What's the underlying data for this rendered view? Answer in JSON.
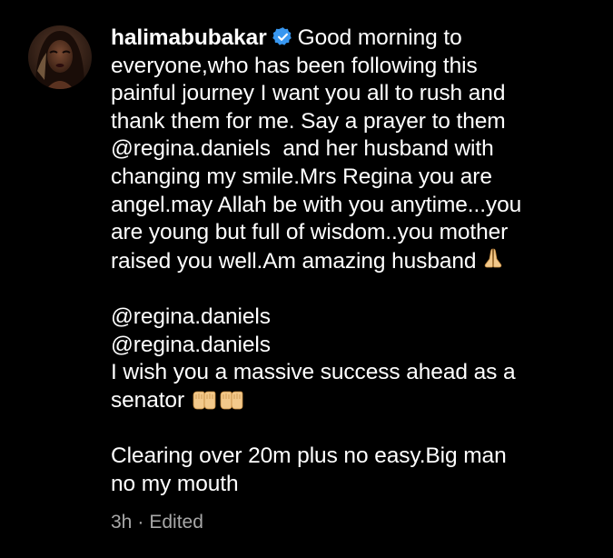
{
  "comment": {
    "username": "halimabubakar",
    "verified": true,
    "verified_color": "#3897f0",
    "text_lines": {
      "l0": "Good morning to",
      "l1": "everyone,who has been following this",
      "l2": "painful journey I want you all to rush and",
      "l3": "thank them for me. Say a prayer to them",
      "l4_mention": "@regina.daniels",
      "l4_rest": "  and her husband with",
      "l5": "changing my smile.Mrs Regina you are",
      "l6": "angel.may Allah be with you anytime...you",
      "l7": "are young but full of wisdom..you mother",
      "l8": "raised you well.Am amazing husband",
      "l10": "@regina.daniels",
      "l11": "@regina.daniels",
      "l12": "I wish you a massive success ahead as a",
      "l13": "senator",
      "l15": "Clearing over 20m plus no easy.Big man",
      "l16": "no my mouth"
    },
    "emojis": [
      "folded-hands-icon",
      "palms-up-together-icon",
      "palms-up-together-icon"
    ],
    "timestamp": "3h",
    "separator": "·",
    "edited_label": "Edited"
  },
  "theme": {
    "background": "#000000",
    "text": "#ffffff",
    "meta_text": "#a8a8a8",
    "emoji_skin": "#f3c98b"
  }
}
